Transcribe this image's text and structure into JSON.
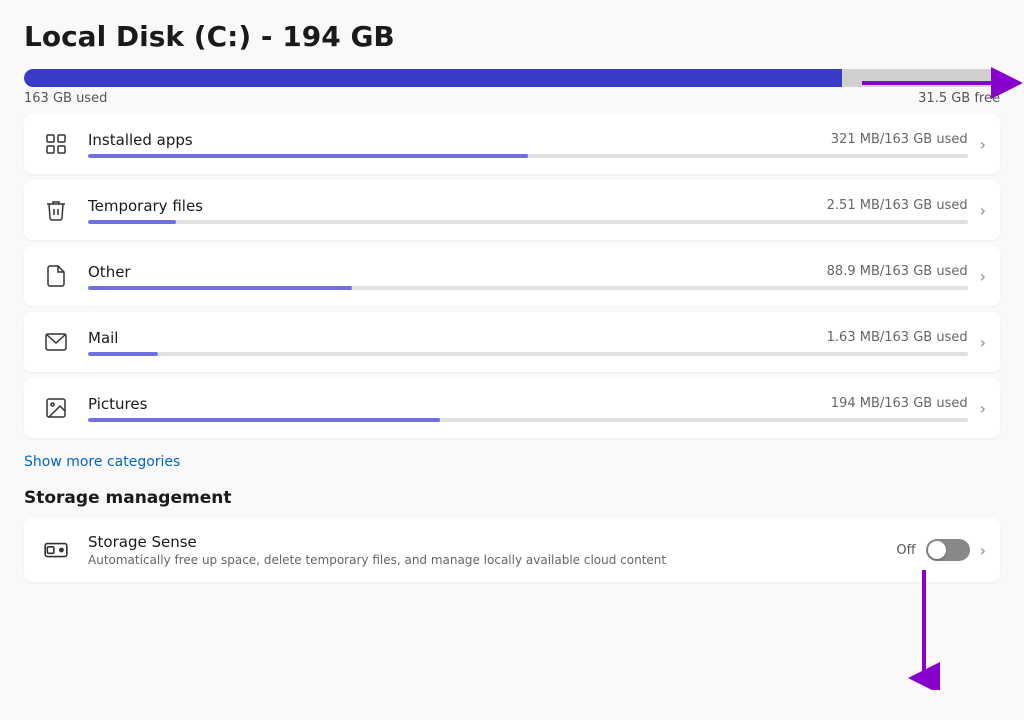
{
  "title": "Local Disk (C:) - 194 GB",
  "storage": {
    "used_label": "163 GB used",
    "free_label": "31.5 GB free",
    "used_percent": 83.8
  },
  "categories": [
    {
      "name": "Installed apps",
      "size": "321 MB/163 GB used",
      "bar_percent": 0.5,
      "icon": "apps"
    },
    {
      "name": "Temporary files",
      "size": "2.51 MB/163 GB used",
      "bar_percent": 0.1,
      "icon": "trash"
    },
    {
      "name": "Other",
      "size": "88.9 MB/163 GB used",
      "bar_percent": 0.3,
      "icon": "file"
    },
    {
      "name": "Mail",
      "size": "1.63 MB/163 GB used",
      "bar_percent": 0.08,
      "icon": "mail"
    },
    {
      "name": "Pictures",
      "size": "194 MB/163 GB used",
      "bar_percent": 0.4,
      "icon": "picture"
    }
  ],
  "show_more_label": "Show more categories",
  "storage_management": {
    "title": "Storage management",
    "sense": {
      "name": "Storage Sense",
      "description": "Automatically free up space, delete temporary files, and manage locally available cloud content",
      "toggle_state": "Off"
    }
  },
  "icons": {
    "chevron": "›"
  }
}
